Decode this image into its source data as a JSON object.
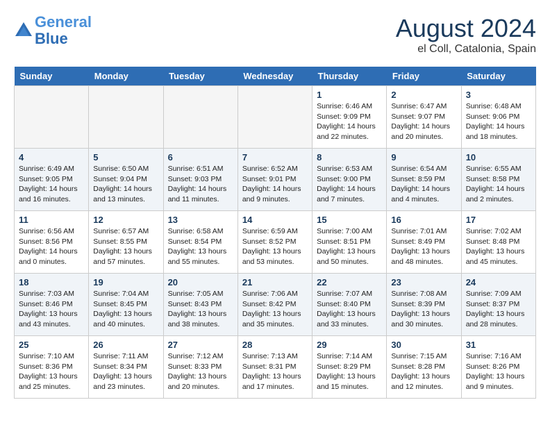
{
  "header": {
    "logo_line1": "General",
    "logo_line2": "Blue",
    "month_year": "August 2024",
    "location": "el Coll, Catalonia, Spain"
  },
  "days_of_week": [
    "Sunday",
    "Monday",
    "Tuesday",
    "Wednesday",
    "Thursday",
    "Friday",
    "Saturday"
  ],
  "weeks": [
    [
      {
        "day": "",
        "info": ""
      },
      {
        "day": "",
        "info": ""
      },
      {
        "day": "",
        "info": ""
      },
      {
        "day": "",
        "info": ""
      },
      {
        "day": "1",
        "info": "Sunrise: 6:46 AM\nSunset: 9:09 PM\nDaylight: 14 hours\nand 22 minutes."
      },
      {
        "day": "2",
        "info": "Sunrise: 6:47 AM\nSunset: 9:07 PM\nDaylight: 14 hours\nand 20 minutes."
      },
      {
        "day": "3",
        "info": "Sunrise: 6:48 AM\nSunset: 9:06 PM\nDaylight: 14 hours\nand 18 minutes."
      }
    ],
    [
      {
        "day": "4",
        "info": "Sunrise: 6:49 AM\nSunset: 9:05 PM\nDaylight: 14 hours\nand 16 minutes."
      },
      {
        "day": "5",
        "info": "Sunrise: 6:50 AM\nSunset: 9:04 PM\nDaylight: 14 hours\nand 13 minutes."
      },
      {
        "day": "6",
        "info": "Sunrise: 6:51 AM\nSunset: 9:03 PM\nDaylight: 14 hours\nand 11 minutes."
      },
      {
        "day": "7",
        "info": "Sunrise: 6:52 AM\nSunset: 9:01 PM\nDaylight: 14 hours\nand 9 minutes."
      },
      {
        "day": "8",
        "info": "Sunrise: 6:53 AM\nSunset: 9:00 PM\nDaylight: 14 hours\nand 7 minutes."
      },
      {
        "day": "9",
        "info": "Sunrise: 6:54 AM\nSunset: 8:59 PM\nDaylight: 14 hours\nand 4 minutes."
      },
      {
        "day": "10",
        "info": "Sunrise: 6:55 AM\nSunset: 8:58 PM\nDaylight: 14 hours\nand 2 minutes."
      }
    ],
    [
      {
        "day": "11",
        "info": "Sunrise: 6:56 AM\nSunset: 8:56 PM\nDaylight: 14 hours\nand 0 minutes."
      },
      {
        "day": "12",
        "info": "Sunrise: 6:57 AM\nSunset: 8:55 PM\nDaylight: 13 hours\nand 57 minutes."
      },
      {
        "day": "13",
        "info": "Sunrise: 6:58 AM\nSunset: 8:54 PM\nDaylight: 13 hours\nand 55 minutes."
      },
      {
        "day": "14",
        "info": "Sunrise: 6:59 AM\nSunset: 8:52 PM\nDaylight: 13 hours\nand 53 minutes."
      },
      {
        "day": "15",
        "info": "Sunrise: 7:00 AM\nSunset: 8:51 PM\nDaylight: 13 hours\nand 50 minutes."
      },
      {
        "day": "16",
        "info": "Sunrise: 7:01 AM\nSunset: 8:49 PM\nDaylight: 13 hours\nand 48 minutes."
      },
      {
        "day": "17",
        "info": "Sunrise: 7:02 AM\nSunset: 8:48 PM\nDaylight: 13 hours\nand 45 minutes."
      }
    ],
    [
      {
        "day": "18",
        "info": "Sunrise: 7:03 AM\nSunset: 8:46 PM\nDaylight: 13 hours\nand 43 minutes."
      },
      {
        "day": "19",
        "info": "Sunrise: 7:04 AM\nSunset: 8:45 PM\nDaylight: 13 hours\nand 40 minutes."
      },
      {
        "day": "20",
        "info": "Sunrise: 7:05 AM\nSunset: 8:43 PM\nDaylight: 13 hours\nand 38 minutes."
      },
      {
        "day": "21",
        "info": "Sunrise: 7:06 AM\nSunset: 8:42 PM\nDaylight: 13 hours\nand 35 minutes."
      },
      {
        "day": "22",
        "info": "Sunrise: 7:07 AM\nSunset: 8:40 PM\nDaylight: 13 hours\nand 33 minutes."
      },
      {
        "day": "23",
        "info": "Sunrise: 7:08 AM\nSunset: 8:39 PM\nDaylight: 13 hours\nand 30 minutes."
      },
      {
        "day": "24",
        "info": "Sunrise: 7:09 AM\nSunset: 8:37 PM\nDaylight: 13 hours\nand 28 minutes."
      }
    ],
    [
      {
        "day": "25",
        "info": "Sunrise: 7:10 AM\nSunset: 8:36 PM\nDaylight: 13 hours\nand 25 minutes."
      },
      {
        "day": "26",
        "info": "Sunrise: 7:11 AM\nSunset: 8:34 PM\nDaylight: 13 hours\nand 23 minutes."
      },
      {
        "day": "27",
        "info": "Sunrise: 7:12 AM\nSunset: 8:33 PM\nDaylight: 13 hours\nand 20 minutes."
      },
      {
        "day": "28",
        "info": "Sunrise: 7:13 AM\nSunset: 8:31 PM\nDaylight: 13 hours\nand 17 minutes."
      },
      {
        "day": "29",
        "info": "Sunrise: 7:14 AM\nSunset: 8:29 PM\nDaylight: 13 hours\nand 15 minutes."
      },
      {
        "day": "30",
        "info": "Sunrise: 7:15 AM\nSunset: 8:28 PM\nDaylight: 13 hours\nand 12 minutes."
      },
      {
        "day": "31",
        "info": "Sunrise: 7:16 AM\nSunset: 8:26 PM\nDaylight: 13 hours\nand 9 minutes."
      }
    ]
  ]
}
